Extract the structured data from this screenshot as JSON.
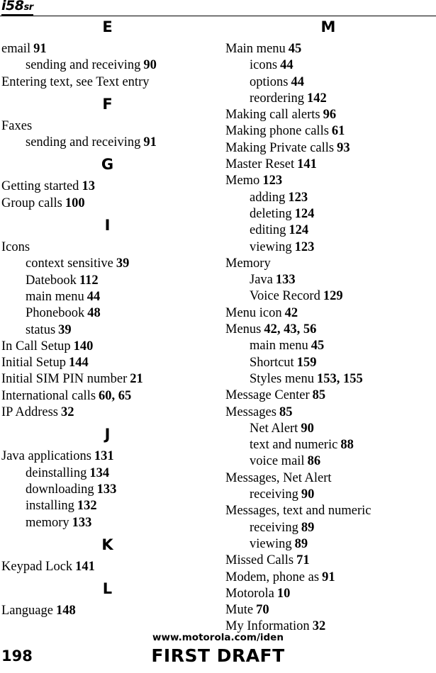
{
  "header": {
    "logo_main": "i58",
    "logo_suffix": "sr"
  },
  "footer": {
    "url": "www.motorola.com/iden",
    "page_number": "198",
    "draft_label": "FIRST DRAFT"
  },
  "index": {
    "columns": [
      {
        "name": "left",
        "sections": [
          {
            "letter": "E",
            "entries": [
              {
                "level": 1,
                "label": "email",
                "pages": "91"
              },
              {
                "level": 2,
                "label": "sending and receiving",
                "pages": "90"
              },
              {
                "level": 1,
                "label": "Entering text, see Text entry",
                "pages": ""
              }
            ]
          },
          {
            "letter": "F",
            "entries": [
              {
                "level": 1,
                "label": "Faxes",
                "pages": ""
              },
              {
                "level": 2,
                "label": "sending and receiving",
                "pages": "91"
              }
            ]
          },
          {
            "letter": "G",
            "entries": [
              {
                "level": 1,
                "label": "Getting started",
                "pages": "13"
              },
              {
                "level": 1,
                "label": "Group calls",
                "pages": "100"
              }
            ]
          },
          {
            "letter": "I",
            "entries": [
              {
                "level": 1,
                "label": "Icons",
                "pages": ""
              },
              {
                "level": 2,
                "label": "context sensitive",
                "pages": "39"
              },
              {
                "level": 2,
                "label": "Datebook",
                "pages": "112"
              },
              {
                "level": 2,
                "label": "main menu",
                "pages": "44"
              },
              {
                "level": 2,
                "label": "Phonebook",
                "pages": "48"
              },
              {
                "level": 2,
                "label": "status",
                "pages": "39"
              },
              {
                "level": 1,
                "label": "In Call Setup",
                "pages": "140"
              },
              {
                "level": 1,
                "label": "Initial Setup",
                "pages": "144"
              },
              {
                "level": 1,
                "label": "Initial SIM PIN number",
                "pages": "21"
              },
              {
                "level": 1,
                "label": "International calls",
                "pages": "60, 65"
              },
              {
                "level": 1,
                "label": "IP Address",
                "pages": "32"
              }
            ]
          },
          {
            "letter": "J",
            "entries": [
              {
                "level": 1,
                "label": "Java applications",
                "pages": "131"
              },
              {
                "level": 2,
                "label": "deinstalling",
                "pages": "134"
              },
              {
                "level": 2,
                "label": "downloading",
                "pages": "133"
              },
              {
                "level": 2,
                "label": "installing",
                "pages": "132"
              },
              {
                "level": 2,
                "label": "memory",
                "pages": "133"
              }
            ]
          },
          {
            "letter": "K",
            "entries": [
              {
                "level": 1,
                "label": "Keypad Lock",
                "pages": "141"
              }
            ]
          },
          {
            "letter": "L",
            "entries": [
              {
                "level": 1,
                "label": "Language",
                "pages": "148"
              }
            ]
          }
        ]
      },
      {
        "name": "right",
        "sections": [
          {
            "letter": "M",
            "entries": [
              {
                "level": 1,
                "label": "Main menu",
                "pages": "45"
              },
              {
                "level": 2,
                "label": "icons",
                "pages": "44"
              },
              {
                "level": 2,
                "label": "options",
                "pages": "44"
              },
              {
                "level": 2,
                "label": "reordering",
                "pages": "142"
              },
              {
                "level": 1,
                "label": "Making call alerts",
                "pages": "96"
              },
              {
                "level": 1,
                "label": "Making phone calls",
                "pages": "61"
              },
              {
                "level": 1,
                "label": "Making Private calls",
                "pages": "93"
              },
              {
                "level": 1,
                "label": "Master Reset",
                "pages": "141"
              },
              {
                "level": 1,
                "label": "Memo",
                "pages": "123"
              },
              {
                "level": 2,
                "label": "adding",
                "pages": "123"
              },
              {
                "level": 2,
                "label": "deleting",
                "pages": "124"
              },
              {
                "level": 2,
                "label": "editing",
                "pages": "124"
              },
              {
                "level": 2,
                "label": "viewing",
                "pages": "123"
              },
              {
                "level": 1,
                "label": "Memory",
                "pages": ""
              },
              {
                "level": 2,
                "label": "Java",
                "pages": "133"
              },
              {
                "level": 2,
                "label": "Voice Record",
                "pages": "129"
              },
              {
                "level": 1,
                "label": "Menu icon",
                "pages": "42"
              },
              {
                "level": 1,
                "label": "Menus",
                "pages": "42, 43, 56"
              },
              {
                "level": 2,
                "label": "main menu",
                "pages": "45"
              },
              {
                "level": 2,
                "label": "Shortcut",
                "pages": "159"
              },
              {
                "level": 2,
                "label": "Styles menu",
                "pages": "153, 155"
              },
              {
                "level": 1,
                "label": "Message Center",
                "pages": "85"
              },
              {
                "level": 1,
                "label": "Messages",
                "pages": "85"
              },
              {
                "level": 2,
                "label": "Net Alert",
                "pages": "90"
              },
              {
                "level": 2,
                "label": "text and numeric",
                "pages": "88"
              },
              {
                "level": 2,
                "label": "voice mail",
                "pages": "86"
              },
              {
                "level": 1,
                "label": "Messages, Net Alert",
                "pages": ""
              },
              {
                "level": 2,
                "label": "receiving",
                "pages": "90"
              },
              {
                "level": 1,
                "label": "Messages, text and numeric",
                "pages": ""
              },
              {
                "level": 2,
                "label": "receiving",
                "pages": "89"
              },
              {
                "level": 2,
                "label": "viewing",
                "pages": "89"
              },
              {
                "level": 1,
                "label": "Missed Calls",
                "pages": "71"
              },
              {
                "level": 1,
                "label": "Modem, phone as",
                "pages": "91"
              },
              {
                "level": 1,
                "label": "Motorola",
                "pages": "10"
              },
              {
                "level": 1,
                "label": "Mute",
                "pages": "70"
              },
              {
                "level": 1,
                "label": "My Information",
                "pages": "32"
              }
            ]
          }
        ]
      }
    ]
  }
}
